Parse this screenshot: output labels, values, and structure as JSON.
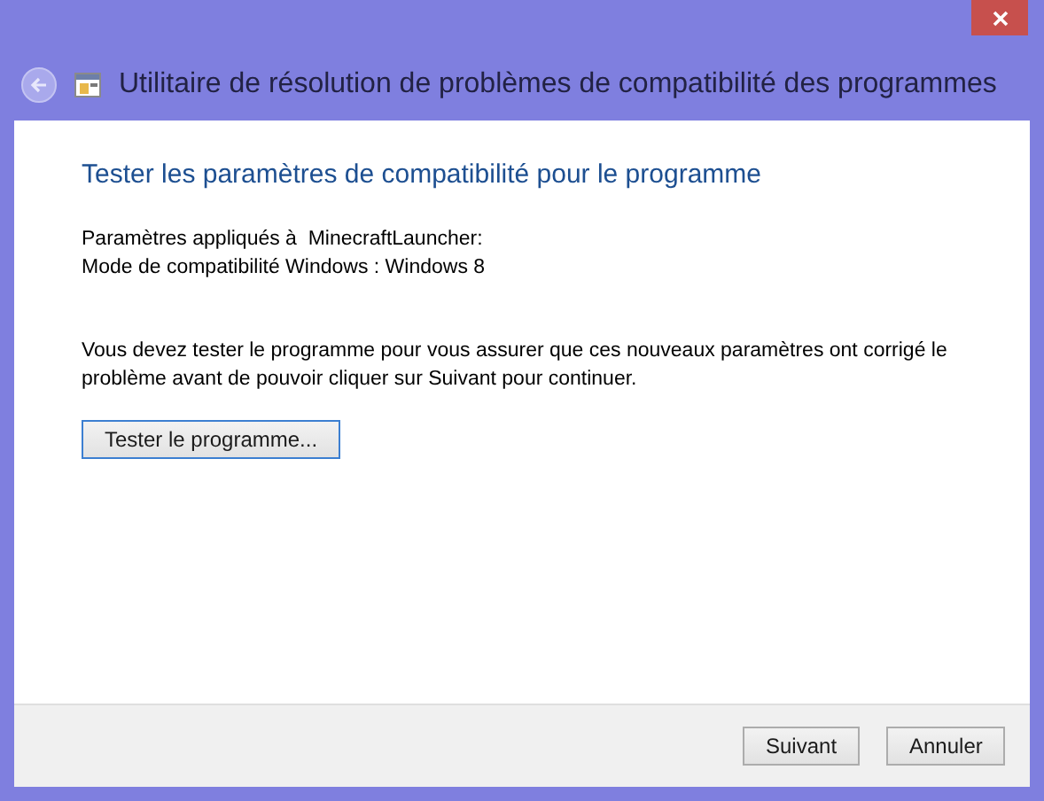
{
  "window": {
    "title": "Utilitaire de résolution de problèmes de compatibilité des programmes"
  },
  "heading": "Tester les paramètres de compatibilité pour le programme",
  "settings": [
    "Paramètres appliqués à  MinecraftLauncher:",
    "Mode de compatibilité Windows : Windows 8"
  ],
  "instructions": "Vous devez tester le programme pour vous assurer que ces nouveaux paramètres ont corrigé le problème avant de pouvoir cliquer sur Suivant pour continuer.",
  "test_button": {
    "label": "Tester le programme...",
    "focused": true
  },
  "buttons": [
    {
      "label": "Suivant",
      "focused": false
    },
    {
      "label": "Annuler",
      "focused": false
    }
  ]
}
